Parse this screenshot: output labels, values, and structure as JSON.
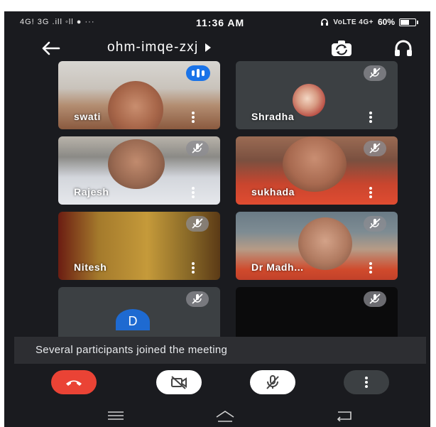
{
  "status_bar": {
    "left_indicators": "4G! 3G .ill ◦ll ● ···",
    "time": "11:36 AM",
    "signal": "VoLTE 4G+",
    "battery": "60%"
  },
  "header": {
    "meeting_code": "ohm-imqe-zxj"
  },
  "participants": [
    {
      "name": "swati",
      "mic": "speaking"
    },
    {
      "name": "Shradha",
      "mic": "muted"
    },
    {
      "name": "Rajesh",
      "mic": "muted"
    },
    {
      "name": "sukhada",
      "mic": "muted"
    },
    {
      "name": "Nitesh",
      "mic": "muted"
    },
    {
      "name": "Dr Madh...",
      "mic": "muted"
    },
    {
      "name": "",
      "avatar_letter": "D",
      "mic": "muted"
    },
    {
      "name": "",
      "mic": "muted"
    }
  ],
  "toast": {
    "message": "Several participants joined the meeting"
  },
  "controls": {
    "end_call": "phone-end-icon",
    "camera": "camera-off-icon",
    "mic": "mic-off-icon",
    "more": "more-vert-icon"
  },
  "colors": {
    "background": "#1a1b1f",
    "end_call": "#ea4335",
    "speaking_badge": "#1a73e8",
    "avatar_d": "#1e6ad1"
  }
}
